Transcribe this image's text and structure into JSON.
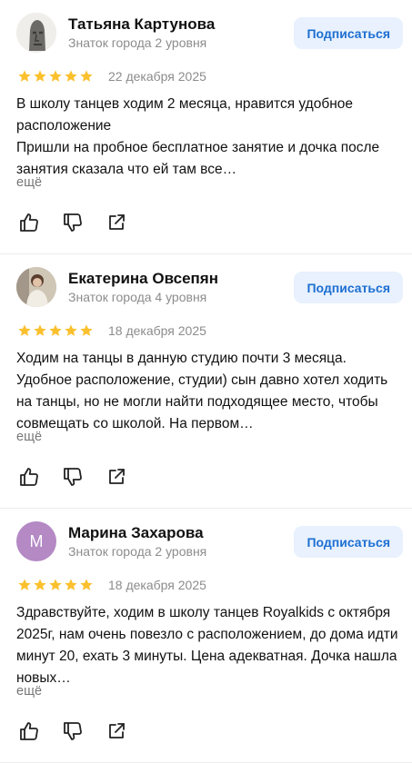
{
  "star_color": "#fbc02d",
  "reviews": [
    {
      "name": "Татьяна Картунова",
      "level": "Знаток города 2 уровня",
      "subscribe_label": "Подписаться",
      "date": "22 декабря 2025",
      "rating": 5,
      "text": "В школу танцев ходим 2 месяца, нравится удобное расположение\nПришли на пробное бесплатное занятие и дочка после занятия сказала что ей там все…",
      "more_label": "ещё"
    },
    {
      "name": "Екатерина Овсепян",
      "level": "Знаток города 4 уровня",
      "subscribe_label": "Подписаться",
      "date": "18 декабря 2025",
      "rating": 5,
      "text": "Ходим на танцы в данную студию почти 3 месяца. Удобное расположение, студии) сын давно хотел ходить на танцы, но не могли найти подходящее место, чтобы совмещать со школой. На первом…",
      "more_label": "ещё"
    },
    {
      "name": "Марина Захарова",
      "level": "Знаток города 2 уровня",
      "subscribe_label": "Подписаться",
      "date": "18 декабря 2025",
      "rating": 5,
      "avatar_letter": "М",
      "avatar_color": "#b489c4",
      "text": "Здравствуйте, ходим в школу танцев Royalkids с октября 2025г, нам очень повезло с расположением, до дома идти минут 20, ехать 3 минуты. Цена адекватная. Дочка нашла новых…",
      "more_label": "ещё"
    }
  ]
}
